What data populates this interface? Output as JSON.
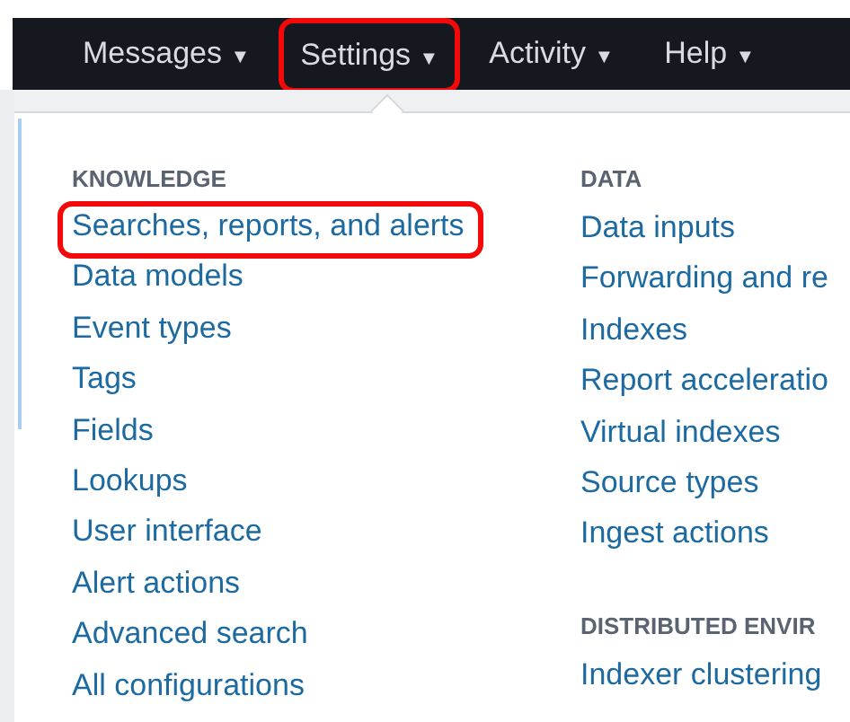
{
  "menu_bar": [
    {
      "label": "Messages",
      "caret": "▼",
      "highlighted": false
    },
    {
      "label": "Settings",
      "caret": "▼",
      "highlighted": true
    },
    {
      "label": "Activity",
      "caret": "▼",
      "highlighted": false
    },
    {
      "label": "Help",
      "caret": "▼",
      "highlighted": false
    }
  ],
  "columns": [
    {
      "sections": [
        {
          "heading": "KNOWLEDGE",
          "links": [
            {
              "label": "Searches, reports, and alerts",
              "highlighted": true
            },
            {
              "label": "Data models",
              "highlighted": false
            },
            {
              "label": "Event types",
              "highlighted": false
            },
            {
              "label": "Tags",
              "highlighted": false
            },
            {
              "label": "Fields",
              "highlighted": false
            },
            {
              "label": "Lookups",
              "highlighted": false
            },
            {
              "label": "User interface",
              "highlighted": false
            },
            {
              "label": "Alert actions",
              "highlighted": false
            },
            {
              "label": "Advanced search",
              "highlighted": false
            },
            {
              "label": "All configurations",
              "highlighted": false
            }
          ]
        }
      ]
    },
    {
      "sections": [
        {
          "heading": "DATA",
          "links": [
            {
              "label": "Data inputs",
              "highlighted": false
            },
            {
              "label": "Forwarding and re",
              "highlighted": false
            },
            {
              "label": "Indexes",
              "highlighted": false
            },
            {
              "label": "Report acceleratio",
              "highlighted": false
            },
            {
              "label": "Virtual indexes",
              "highlighted": false
            },
            {
              "label": "Source types",
              "highlighted": false
            },
            {
              "label": "Ingest actions",
              "highlighted": false
            }
          ]
        },
        {
          "heading": "DISTRIBUTED ENVIR",
          "links": [
            {
              "label": "Indexer clustering",
              "highlighted": false
            }
          ]
        }
      ]
    }
  ]
}
